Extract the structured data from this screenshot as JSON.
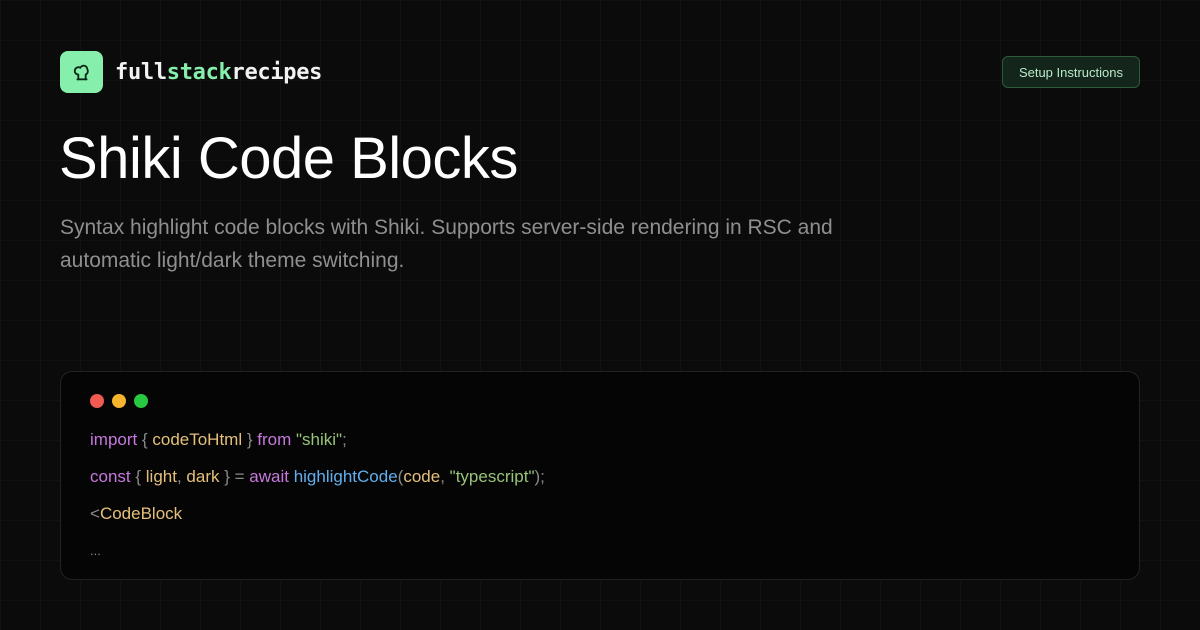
{
  "brand": {
    "part1": "full",
    "part2": "stack",
    "part3": "recipes",
    "logo_icon": "chef-hat-icon",
    "accent_color": "#86efac"
  },
  "header": {
    "setup_button": "Setup Instructions"
  },
  "hero": {
    "title": "Shiki Code Blocks",
    "subtitle_line1": "Syntax highlight code blocks with Shiki. Supports server-side rendering in RSC and",
    "subtitle_line2": "automatic light/dark theme switching."
  },
  "window_controls": {
    "close_color": "#ef5a52",
    "minimize_color": "#f5b32e",
    "maximize_color": "#28c840"
  },
  "code_lines": [
    [
      {
        "t": "import",
        "c": "kw"
      },
      {
        "t": " { ",
        "c": "pn"
      },
      {
        "t": "codeToHtml",
        "c": "var"
      },
      {
        "t": " } ",
        "c": "pn"
      },
      {
        "t": "from",
        "c": "kw"
      },
      {
        "t": " ",
        "c": "pn"
      },
      {
        "t": "\"shiki\"",
        "c": "str"
      },
      {
        "t": ";",
        "c": "pn"
      }
    ],
    [
      {
        "t": "const",
        "c": "kw"
      },
      {
        "t": " { ",
        "c": "pn"
      },
      {
        "t": "light",
        "c": "var"
      },
      {
        "t": ", ",
        "c": "pn"
      },
      {
        "t": "dark",
        "c": "var"
      },
      {
        "t": " } = ",
        "c": "pn"
      },
      {
        "t": "await",
        "c": "kw"
      },
      {
        "t": " ",
        "c": "pn"
      },
      {
        "t": "highlightCode",
        "c": "fn"
      },
      {
        "t": "(",
        "c": "pn"
      },
      {
        "t": "code",
        "c": "var"
      },
      {
        "t": ", ",
        "c": "pn"
      },
      {
        "t": "\"typescript\"",
        "c": "str"
      },
      {
        "t": ");",
        "c": "pn"
      }
    ],
    [
      {
        "t": "<",
        "c": "pn"
      },
      {
        "t": "CodeBlock",
        "c": "var"
      }
    ],
    [
      {
        "t": "...",
        "c": "pn"
      }
    ]
  ]
}
